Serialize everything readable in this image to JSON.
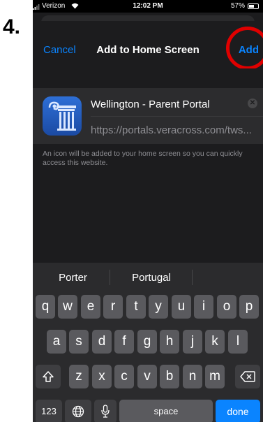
{
  "step_label": "4.",
  "status": {
    "carrier": "Verizon",
    "time": "12:02 PM",
    "battery": "57%"
  },
  "nav": {
    "cancel": "Cancel",
    "title": "Add to Home Screen",
    "add": "Add"
  },
  "app": {
    "name": "Wellington - Parent Portal",
    "url": "https://portals.veracross.com/tws..."
  },
  "hint": "An icon will be added to your home screen so you can quickly access this website.",
  "keyboard": {
    "suggestions": [
      "Porter",
      "Portugal",
      ""
    ],
    "row1": [
      "q",
      "w",
      "e",
      "r",
      "t",
      "y",
      "u",
      "i",
      "o",
      "p"
    ],
    "row2": [
      "a",
      "s",
      "d",
      "f",
      "g",
      "h",
      "j",
      "k",
      "l"
    ],
    "row3": [
      "z",
      "x",
      "c",
      "v",
      "b",
      "n",
      "m"
    ],
    "numbers_key": "123",
    "space_key": "space",
    "done_key": "done"
  },
  "colors": {
    "accent": "#0a84ff",
    "highlight": "#e00000",
    "background": "#1c1c1e"
  },
  "icons": [
    "wifi-icon",
    "signal-icon",
    "battery-icon",
    "clear-icon",
    "shift-icon",
    "backspace-icon",
    "globe-icon",
    "microphone-icon",
    "app-icon-column"
  ]
}
